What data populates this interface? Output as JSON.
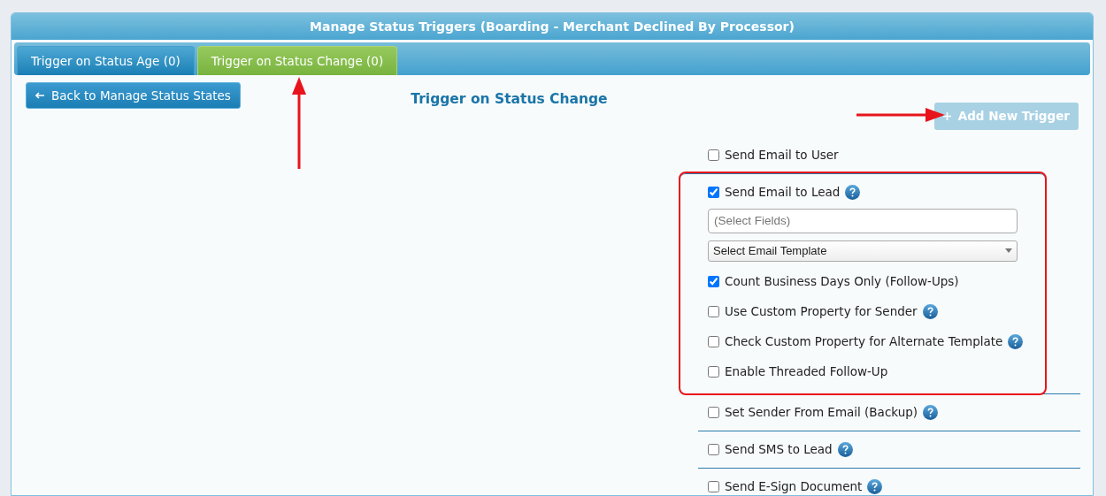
{
  "window": {
    "title": "Manage Status Triggers (Boarding - Merchant Declined By Processor)"
  },
  "tabs": [
    {
      "label": "Trigger on Status Age (0)",
      "selected": false
    },
    {
      "label": "Trigger on Status Change (0)",
      "selected": true
    }
  ],
  "back_button": {
    "label": "Back to Manage Status States"
  },
  "heading": "Trigger on Status Change",
  "add_button": {
    "label": "Add New Trigger",
    "disabled": true
  },
  "sections": [
    {
      "label": "Send Email to User",
      "checked": false,
      "help": false,
      "highlighted": false
    },
    {
      "label": "Send Email to Lead",
      "checked": true,
      "help": true,
      "highlighted": true,
      "fields": {
        "placeholder": "(Select Fields)"
      },
      "template_select": {
        "value": "Select Email Template"
      },
      "options": [
        {
          "label": "Count Business Days Only (Follow-Ups)",
          "checked": true,
          "help": false
        },
        {
          "label": "Use Custom Property for Sender",
          "checked": false,
          "help": true
        },
        {
          "label": "Check Custom Property for Alternate Template",
          "checked": false,
          "help": true
        },
        {
          "label": "Enable Threaded Follow-Up",
          "checked": false,
          "help": false
        }
      ]
    },
    {
      "label": "Set Sender From Email (Backup)",
      "checked": false,
      "help": true,
      "highlighted": false
    },
    {
      "label": "Send SMS to Lead",
      "checked": false,
      "help": true,
      "highlighted": false
    },
    {
      "label": "Send E-Sign Document",
      "checked": false,
      "help": true,
      "highlighted": false
    }
  ]
}
